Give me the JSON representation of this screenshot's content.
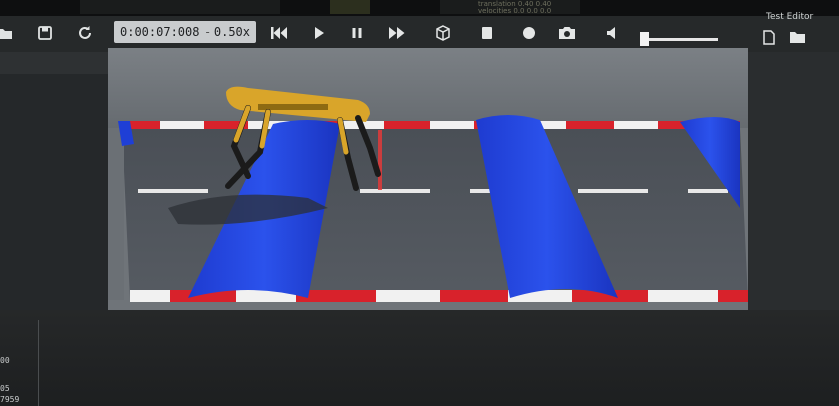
{
  "playback": {
    "time": "0:00:07:008",
    "separator": "-",
    "speed": "0.50x"
  },
  "toolbar": {
    "editor_label": "Test Editor"
  },
  "top_strip": {
    "faint_text_1": "translation 0.40 0.40",
    "faint_text_2": "velocities 0.0 0.0 0.0"
  },
  "side_panel": {
    "values": [
      "00",
      "05",
      "7959"
    ]
  },
  "scene": {
    "description_colors": {
      "floor": "#52575e",
      "ramp": "#1f3fd6",
      "stripe_red": "#d8222b",
      "stripe_white": "#f1f1f1",
      "robot": "#d9a52a"
    }
  }
}
